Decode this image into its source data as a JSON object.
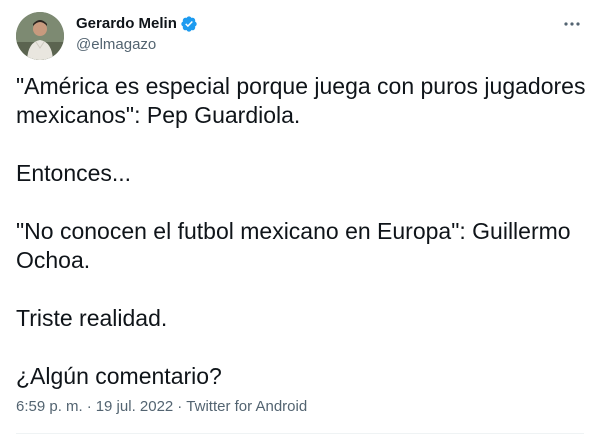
{
  "user": {
    "display_name": "Gerardo Melin",
    "handle": "@elmagazo",
    "avatar_icon": "user-avatar",
    "verified_icon": "verified-badge-icon",
    "verified_color": "#1d9bf0"
  },
  "more_icon": "more-options-icon",
  "tweet": {
    "paragraphs": [
      "\"América es especial porque juega con puros jugadores mexicanos\": Pep Guardiola.",
      "Entonces...",
      "\"No conocen el futbol mexicano en Europa\": Guillermo Ochoa.",
      "Triste realidad.",
      "¿Algún comentario?"
    ]
  },
  "meta": {
    "time": "6:59 p. m.",
    "separator": "·",
    "date": "19 jul. 2022",
    "source": "Twitter for Android"
  },
  "colors": {
    "text": "#0f1419",
    "secondary": "#536471",
    "accent": "#1d9bf0"
  }
}
